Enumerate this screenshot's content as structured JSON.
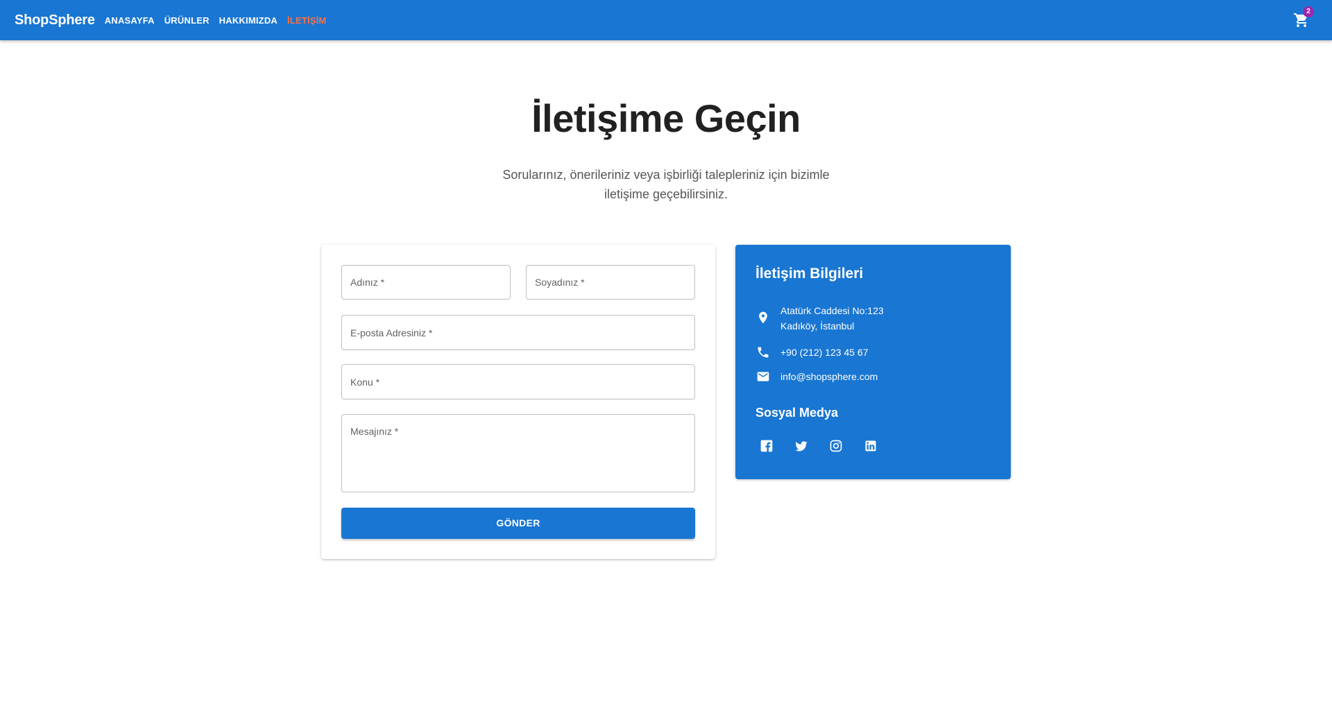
{
  "header": {
    "brand": "ShopSphere",
    "nav": [
      "ANASAYFA",
      "ÜRÜNLER",
      "HAKKIMIZDA",
      "İLETİŞİM"
    ],
    "active_nav": "İLETİŞİM",
    "cart_count": "2",
    "accent_color": "#1976d2",
    "active_color": "#ff7043"
  },
  "hero": {
    "title": "İletişime Geçin",
    "subtitle": "Sorularınız, önerileriniz veya işbirliği talepleriniz için bizimle iletişime geçebilirsiniz."
  },
  "form": {
    "first_name_label": "Adınız *",
    "last_name_label": "Soyadınız *",
    "email_label": "E-posta Adresiniz *",
    "subject_label": "Konu *",
    "message_label": "Mesajınız *",
    "submit_label": "GÖNDER"
  },
  "contact": {
    "title": "İletişim Bilgileri",
    "address_line1": "Atatürk Caddesi No:123",
    "address_line2": "Kadıköy, İstanbul",
    "phone": "+90 (212) 123 45 67",
    "email": "info@shopsphere.com",
    "social_title": "Sosyal Medya",
    "social_icons": [
      "facebook-icon",
      "twitter-icon",
      "instagram-icon",
      "linkedin-icon"
    ]
  }
}
